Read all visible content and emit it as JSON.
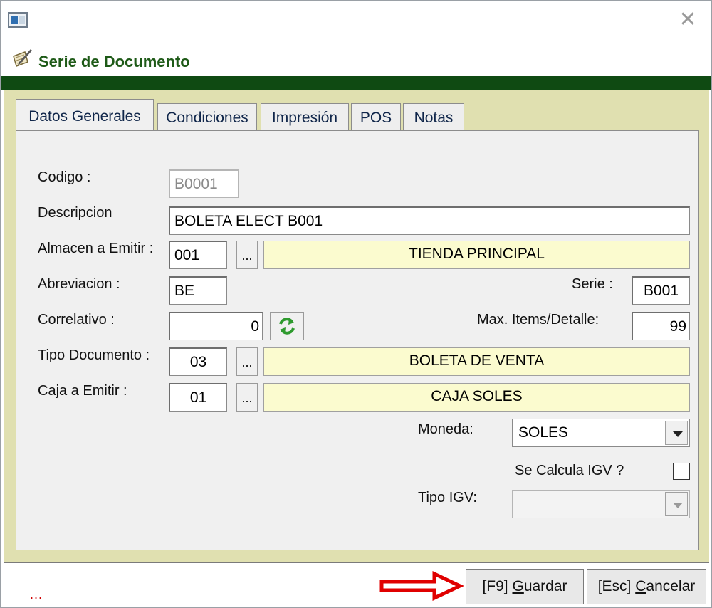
{
  "header": {
    "title": "Serie de Documento"
  },
  "icons": {
    "app": "window-icon",
    "form": "document-pen-icon",
    "close": "close-icon",
    "refresh": "refresh-icon",
    "arrow": "red-arrow-icon"
  },
  "tabs": [
    {
      "label": "Datos Generales",
      "active": true
    },
    {
      "label": "Condiciones"
    },
    {
      "label": "Impresión"
    },
    {
      "label": "POS"
    },
    {
      "label": "Notas"
    }
  ],
  "form": {
    "codigo": {
      "label": "Codigo :",
      "value": "B0001"
    },
    "descripcion": {
      "label": "Descripcion",
      "value": "BOLETA ELECT B001"
    },
    "almacen": {
      "label": "Almacen a Emitir :",
      "code": "001",
      "name": "TIENDA PRINCIPAL"
    },
    "abreviacion": {
      "label": "Abreviacion :",
      "value": "BE"
    },
    "serie": {
      "label": "Serie :",
      "value": "B001"
    },
    "correlativo": {
      "label": "Correlativo :",
      "value": "0"
    },
    "max_items": {
      "label": "Max. Items/Detalle:",
      "value": "99"
    },
    "tipo_documento": {
      "label": "Tipo Documento :",
      "code": "03",
      "name": "BOLETA DE VENTA"
    },
    "caja": {
      "label": "Caja a Emitir :",
      "code": "01",
      "name": "CAJA SOLES"
    },
    "moneda": {
      "label": "Moneda:",
      "value": "SOLES"
    },
    "calcula_igv": {
      "label": "Se Calcula IGV ?",
      "checked": false
    },
    "tipo_igv": {
      "label": "Tipo IGV:",
      "value": ""
    },
    "lookup_label": "..."
  },
  "footer": {
    "status": "...",
    "guardar": {
      "prefix": "[F9] ",
      "accel": "G",
      "rest": "uardar"
    },
    "cancelar": {
      "prefix": "[Esc] ",
      "accel": "C",
      "rest": "ancelar"
    }
  },
  "colors": {
    "title": "#1e5a17",
    "green_bar": "#0f4a12",
    "tab_area": "#e0e0b0",
    "yellow_field": "#fbfbcf",
    "arrow": "#e00000"
  }
}
